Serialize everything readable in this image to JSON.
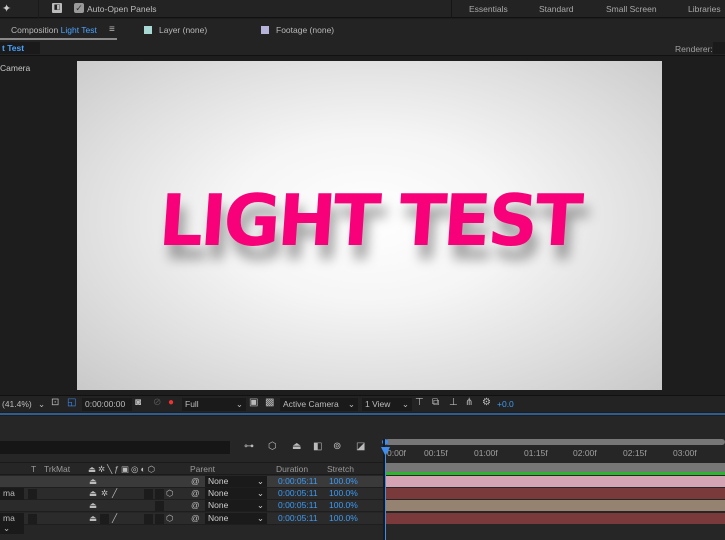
{
  "topbar": {
    "auto_open_label": "Auto-Open Panels",
    "auto_open_checked": true,
    "workspaces": [
      "Essentials",
      "Standard",
      "Small Screen",
      "Libraries"
    ]
  },
  "tabs": {
    "composition_prefix": "Composition",
    "composition_name": "Light Test",
    "layer": "Layer (none)",
    "footage": "Footage (none)",
    "layer_color": "#a8d8d4",
    "footage_color": "#b6b2d8"
  },
  "subbar": {
    "comp_tab": "t Test",
    "renderer_label": "Renderer:"
  },
  "viewer": {
    "camera_label": "Camera",
    "comp_text": "LIGHT TEST",
    "text_color": "#f7007a"
  },
  "viewer_toolbar": {
    "zoom": "(41.4%)",
    "timecode": "0:00:00:00",
    "resolution": "Full",
    "view": "Active Camera",
    "layout": "1 View",
    "exposure": "+0.0"
  },
  "timeline": {
    "columns": {
      "t": "T",
      "trkmat": "TrkMat",
      "parent": "Parent",
      "duration": "Duration",
      "stretch": "Stretch"
    },
    "ruler_ticks": [
      "0:00f",
      "00:15f",
      "01:00f",
      "01:15f",
      "02:00f",
      "02:15f",
      "03:00f"
    ],
    "layers": [
      {
        "trkmat": "",
        "parent": "None",
        "duration": "0:00:05:11",
        "stretch": "100.0%",
        "bar_color": "#d4a4b4"
      },
      {
        "trkmat": "ma",
        "parent": "None",
        "duration": "0:00:05:11",
        "stretch": "100.0%",
        "bar_color": "#7a3a3c"
      },
      {
        "trkmat": "",
        "parent": "None",
        "duration": "0:00:05:11",
        "stretch": "100.0%",
        "bar_color": "#958270"
      },
      {
        "trkmat": "ma",
        "parent": "None",
        "duration": "0:00:05:11",
        "stretch": "100.0%",
        "bar_color": "#7a3a3c"
      }
    ]
  }
}
